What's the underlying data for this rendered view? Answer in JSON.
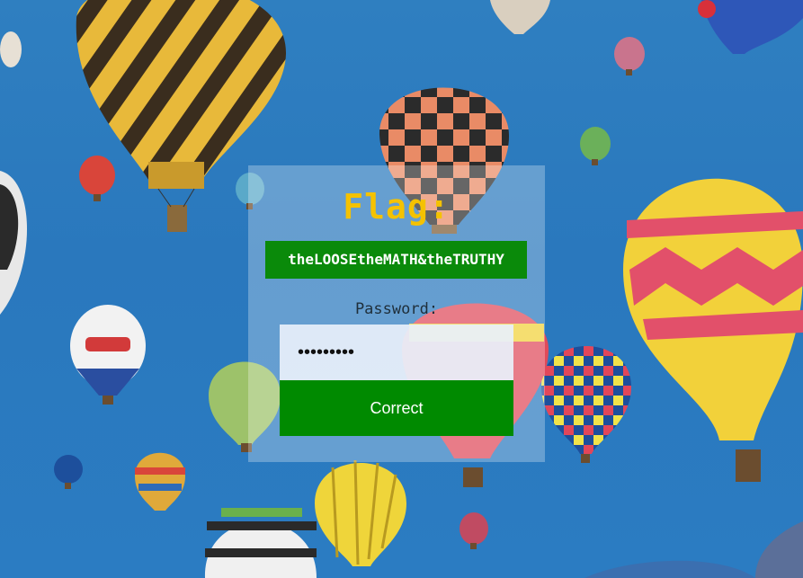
{
  "login_panel": {
    "flag_title": "Flag:",
    "flag_value": "theLOOSEtheMATH&theTRUTHY",
    "password_label": "Password:",
    "password_value": "•••••••••",
    "submit_label": "Correct"
  },
  "background": {
    "scene": "hot-air-balloons",
    "sky_color": "#2a78bd"
  },
  "colors": {
    "flag_title": "#f5c200",
    "flag_box": "#0a8a0a",
    "button": "#008a00"
  }
}
